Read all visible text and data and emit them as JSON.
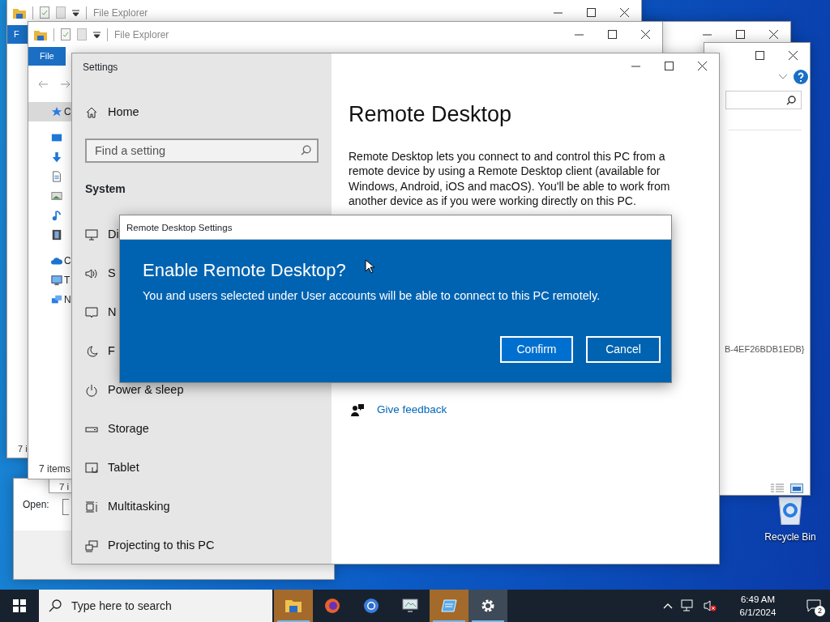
{
  "desktop_icons": [
    {
      "kind": "recycle-bin",
      "label": "Recycle Bin"
    }
  ],
  "explorer_windows": [
    {
      "title": "File Explorer",
      "ribbon_tab": "F",
      "status": "7 i"
    },
    {
      "title": "File Explorer",
      "ribbon_tab": "File",
      "status": "7 items",
      "nav_items": [
        {
          "kind": "quick-access",
          "label": "C",
          "selected": true
        },
        {
          "kind": "desktop",
          "selected": false
        },
        {
          "kind": "downloads",
          "selected": false
        },
        {
          "kind": "documents",
          "selected": false
        },
        {
          "kind": "pictures",
          "selected": false
        },
        {
          "kind": "music",
          "selected": false
        },
        {
          "kind": "videos",
          "selected": false
        },
        {
          "kind": "onedrive",
          "label": "C",
          "selected": false
        },
        {
          "kind": "this-pc",
          "label": "T",
          "selected": false
        },
        {
          "kind": "network",
          "label": "N",
          "selected": false
        }
      ]
    }
  ],
  "lower_window": {
    "status": "7 i"
  },
  "right_window": {
    "path_text": "B-4EF26BDB1EDB}"
  },
  "run_dialog": {
    "open_label": "Open:"
  },
  "settings": {
    "title": "Settings",
    "home": "Home",
    "search_placeholder": "Find a setting",
    "section": "System",
    "nav": [
      {
        "kind": "display",
        "label": "Di"
      },
      {
        "kind": "sound",
        "label": "S"
      },
      {
        "kind": "notifications",
        "label": "N"
      },
      {
        "kind": "focus",
        "label": "F"
      },
      {
        "kind": "power",
        "label": "Power & sleep"
      },
      {
        "kind": "storage",
        "label": "Storage"
      },
      {
        "kind": "tablet",
        "label": "Tablet"
      },
      {
        "kind": "multitasking",
        "label": "Multitasking"
      },
      {
        "kind": "projecting",
        "label": "Projecting to this PC"
      }
    ],
    "page_title": "Remote Desktop",
    "description": "Remote Desktop lets you connect to and control this PC from a remote device by using a Remote Desktop client (available for Windows, Android, iOS and macOS). You'll be able to work from another device as if you were working directly on this PC.",
    "links": [
      {
        "kind": "feedback",
        "label": "Give feedback"
      }
    ]
  },
  "dialog": {
    "title": "Remote Desktop Settings",
    "heading": "Enable Remote Desktop?",
    "message": "You and users selected under User accounts will be able to connect to this PC remotely.",
    "buttons": [
      "Confirm",
      "Cancel"
    ]
  },
  "taskbar": {
    "search_placeholder": "Type here to search",
    "apps": [
      {
        "kind": "explorer",
        "attention": true,
        "selected": false
      },
      {
        "kind": "firefox",
        "attention": false,
        "selected": false
      },
      {
        "kind": "chrome",
        "attention": false,
        "selected": false
      },
      {
        "kind": "monitor",
        "attention": false,
        "selected": false
      },
      {
        "kind": "window",
        "attention": true,
        "selected": false
      },
      {
        "kind": "settings",
        "attention": false,
        "selected": true
      }
    ],
    "time": "6:49 AM",
    "date": "6/1/2024",
    "notification_count": "2"
  }
}
